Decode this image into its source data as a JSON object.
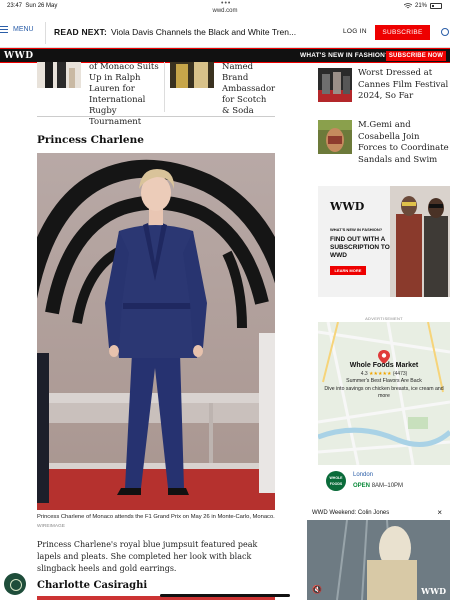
{
  "status": {
    "time": "23:47",
    "date": "Sun 26 May",
    "url": "wwd.com",
    "battery": "21%"
  },
  "header": {
    "menu_label": "MENU",
    "read_next_label": "READ NEXT:",
    "read_next_title": "Viola Davis Channels the Black and White Tren...",
    "login_label": "LOG IN",
    "subscribe_label": "SUBSCRIBE"
  },
  "banner": {
    "logo": "WWD",
    "whats_new": "WHAT'S NEW IN FASHION?",
    "subscribe_now": "SUBSCRIBE NOW"
  },
  "related": [
    {
      "text": "of Monaco Suits Up in Ralph Lauren for International Rugby Tournament"
    },
    {
      "text": "Named Brand Ambassador for Scotch & Soda"
    }
  ],
  "article": {
    "section1_title": "Princess Charlene",
    "caption": "Princess Charlene of Monaco attends the F1 Grand Prix on May 26 in Monte-Carlo, Monaco.",
    "credit": "WIREIMAGE",
    "body": "Princess Charlene's royal blue jumpsuit featured peak lapels and pleats. She completed her look with black slingback heels and gold earrings.",
    "section2_title": "Charlotte Casiraghi"
  },
  "sidebar": {
    "items": [
      {
        "title": "Worst Dressed at Cannes Film Festival 2024, So Far"
      },
      {
        "title": "M.Gemi and Cosabella Join Forces to Coordinate Sandals and Swim"
      }
    ]
  },
  "ad": {
    "logo": "WWD",
    "whats_new": "WHAT'S NEW IN FASHION?",
    "headline": "FIND OUT WITH A SUBSCRIPTION TO WWD",
    "cta": "LEARN MORE",
    "label": "ADVERTISEMENT"
  },
  "map_ad": {
    "name": "Whole Foods Market",
    "rating": "4.3",
    "stars": "★★★★★",
    "reviews": "(4473)",
    "tagline": "Summer's Best Flavors Are Back",
    "desc": "Dive into savings on chicken breasts, ice cream and more",
    "logo_text": "WHOLE FOODS",
    "city": "London",
    "open_label": "OPEN",
    "hours": "8AM–10PM"
  },
  "video": {
    "title": "WWD Weekend: Colin Jones",
    "logo": "WWD"
  },
  "colors": {
    "accent_red": "#e00000",
    "link_blue": "#2b5ea8",
    "jumpsuit_blue": "#2b3773"
  }
}
